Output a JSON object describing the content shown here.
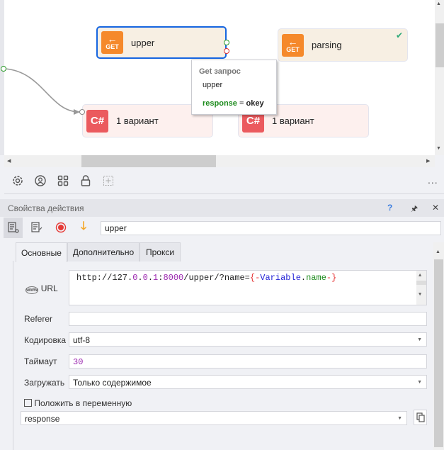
{
  "canvas": {
    "nodes": [
      {
        "type": "GET",
        "label": "upper",
        "selected": true
      },
      {
        "type": "GET",
        "label": "parsing",
        "status": "check-icon"
      },
      {
        "type": "C#",
        "label": "1 вариант"
      },
      {
        "type": "C#",
        "label": "1 вариант"
      }
    ],
    "get_icon_text": "GET",
    "cs_icon_text": "C#",
    "tooltip": {
      "title": "Get запрос",
      "name": "upper",
      "var": "response",
      "eq": "=",
      "value": "okey"
    }
  },
  "toolbar": {
    "icons": [
      "gear-icon",
      "user-icon",
      "grid-icon",
      "lock-icon",
      "add-icon"
    ],
    "more": "..."
  },
  "panel": {
    "title": "Свойства действия",
    "help": "?",
    "pin": "pin-icon",
    "close": "✕",
    "action_name": "upper",
    "tabs": [
      "Основные",
      "Дополнительно",
      "Прокси"
    ],
    "url": {
      "label": "URL",
      "value_parts": {
        "p1": "http://127.",
        "p2": "0",
        "p3": ".",
        "p4": "0",
        "p5": ".",
        "p6": "1",
        ":": ":",
        "p7": "8000",
        "p8": "/upper/?name=",
        "p9": "{-",
        "p10": "Variable",
        "p11": ".",
        "p12": "name",
        "p13": "-}"
      }
    },
    "referer": {
      "label": "Referer",
      "value": ""
    },
    "encoding": {
      "label": "Кодировка",
      "value": "utf-8"
    },
    "timeout": {
      "label": "Таймаут",
      "value": "30"
    },
    "load": {
      "label": "Загружать",
      "value": "Только содержимое"
    },
    "save_to": {
      "label": "Положить в переменную",
      "value": "response"
    }
  },
  "colors": {
    "get": "#f5892b",
    "cs": "#eb5a5e",
    "selected": "#1565e0",
    "var_green": "#1a8a1a",
    "number_purple": "#9b27af"
  }
}
